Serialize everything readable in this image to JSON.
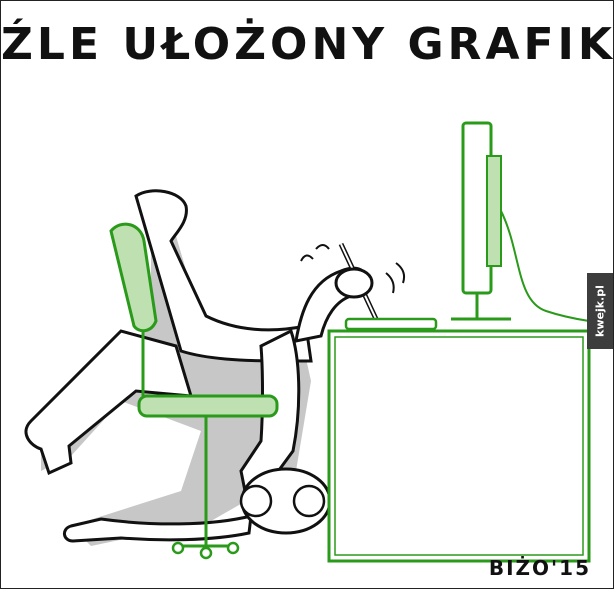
{
  "title": "ŹLE UŁOŻONY GRAFIK",
  "signature": "BIŻO'15",
  "watermark": "kwejk.pl",
  "colors": {
    "line": "#111111",
    "green": "#2a9a1a",
    "green_fill": "#bfe0b0",
    "shadow": "#c7c7c7"
  }
}
